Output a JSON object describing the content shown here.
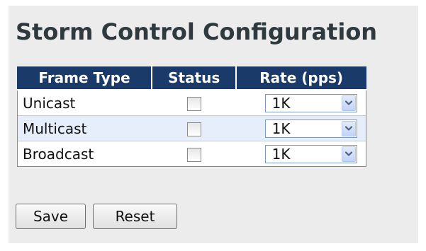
{
  "page": {
    "title": "Storm Control Configuration"
  },
  "table": {
    "headers": {
      "frame_type": "Frame Type",
      "status": "Status",
      "rate": "Rate (pps)"
    },
    "rows": [
      {
        "frame_type": "Unicast",
        "status_checked": false,
        "rate": "1K"
      },
      {
        "frame_type": "Multicast",
        "status_checked": false,
        "rate": "1K"
      },
      {
        "frame_type": "Broadcast",
        "status_checked": false,
        "rate": "1K"
      }
    ]
  },
  "buttons": {
    "save": "Save",
    "reset": "Reset"
  },
  "colors": {
    "header_background": "#1a3a6a",
    "header_text": "#ffffff",
    "alt_row_background": "#e6eefb",
    "page_background": "#ececec"
  }
}
